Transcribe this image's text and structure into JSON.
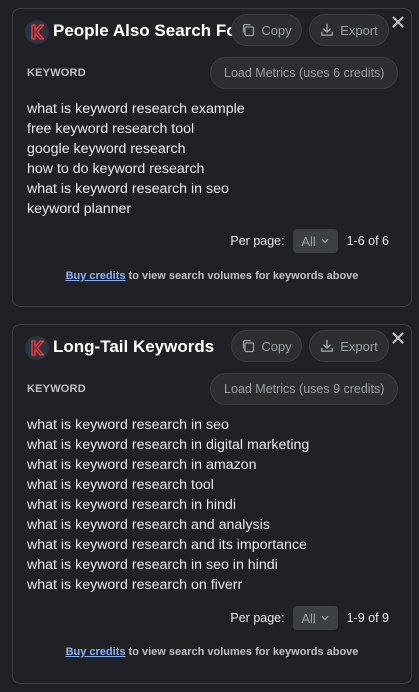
{
  "cards": [
    {
      "title": "People Also Search For",
      "copy_label": "Copy",
      "export_label": "Export",
      "column_header": "KEYWORD",
      "load_metrics_label": "Load Metrics (uses 6 credits)",
      "keywords": [
        "what is keyword research example",
        "free keyword research tool",
        "google keyword research",
        "how to do keyword research",
        "what is keyword research in seo",
        "keyword planner"
      ],
      "per_page_label": "Per page:",
      "per_page_value": "All",
      "range": "1-6 of 6",
      "buy_link": "Buy credits",
      "buy_text": " to view search volumes for keywords above"
    },
    {
      "title": "Long-Tail Keywords",
      "copy_label": "Copy",
      "export_label": "Export",
      "column_header": "KEYWORD",
      "load_metrics_label": "Load Metrics (uses 9 credits)",
      "keywords": [
        "what is keyword research in seo",
        "what is keyword research in digital marketing",
        "what is keyword research in amazon",
        "what is keyword research tool",
        "what is keyword research in hindi",
        "what is keyword research and analysis",
        "what is keyword research and its importance",
        "what is keyword research in seo in hindi",
        "what is keyword research on fiverr"
      ],
      "per_page_label": "Per page:",
      "per_page_value": "All",
      "range": "1-9 of 9",
      "buy_link": "Buy credits",
      "buy_text": " to view search volumes for keywords above"
    }
  ],
  "icons": {
    "logo": "keywords-everywhere-logo-icon",
    "copy": "copy-icon",
    "export": "download-icon",
    "close": "close-icon",
    "dropdown": "chevron-down-icon"
  },
  "colors": {
    "background": "#202124",
    "logo_accent": "#e53935",
    "link": "#8ab4f8"
  }
}
